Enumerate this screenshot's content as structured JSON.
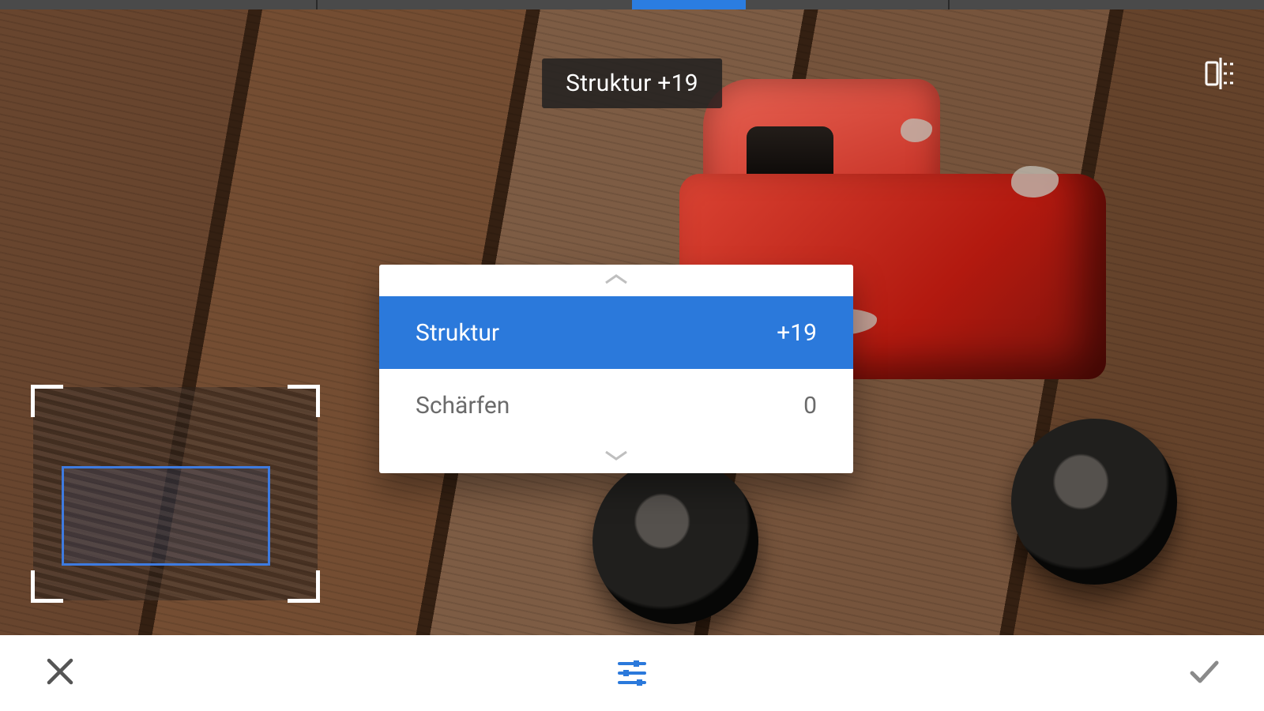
{
  "slider": {
    "center_pct": 50,
    "value_pct": 59,
    "value": 19
  },
  "toast": {
    "text": "Struktur +19"
  },
  "picker": {
    "rows": [
      {
        "label": "Struktur",
        "value": "+19",
        "selected": true
      },
      {
        "label": "Schärfen",
        "value": "0",
        "selected": false
      }
    ]
  },
  "colors": {
    "accent": "#2b79db"
  },
  "icons": {
    "compare": "compare-icon",
    "cancel": "close-icon",
    "adjust": "tune-icon",
    "confirm": "check-icon"
  }
}
